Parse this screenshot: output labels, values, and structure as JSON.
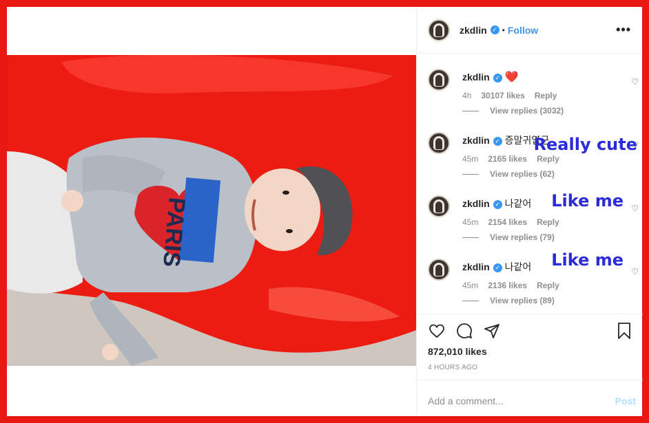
{
  "header": {
    "username": "zkdlin",
    "separator": "•",
    "follow": "Follow",
    "more": "•••"
  },
  "comments": [
    {
      "user": "zkdlin",
      "text": "",
      "emoji": "❤️",
      "time": "4h",
      "likes": "30107 likes",
      "reply": "Reply",
      "replies": "View replies (3032)",
      "overlay": ""
    },
    {
      "user": "zkdlin",
      "text": "증말귀엽군",
      "emoji": "",
      "time": "45m",
      "likes": "2165 likes",
      "reply": "Reply",
      "replies": "View replies (62)",
      "overlay": "Really cute"
    },
    {
      "user": "zkdlin",
      "text": "나같어",
      "emoji": "",
      "time": "45m",
      "likes": "2154 likes",
      "reply": "Reply",
      "replies": "View replies (79)",
      "overlay": "Like me"
    },
    {
      "user": "zkdlin",
      "text": "나같어",
      "emoji": "",
      "time": "45m",
      "likes": "2136 likes",
      "reply": "Reply",
      "replies": "View replies (89)",
      "overlay": "Like me"
    }
  ],
  "post": {
    "likes": "872,010 likes",
    "time": "4 HOURS AGO"
  },
  "composer": {
    "placeholder": "Add a comment...",
    "post": "Post"
  },
  "photo": {
    "sweatshirt_text": "PARIS"
  },
  "colors": {
    "frame": "#e8170f",
    "accent": "#3897f0",
    "overlay_text": "#2b2bd9"
  }
}
